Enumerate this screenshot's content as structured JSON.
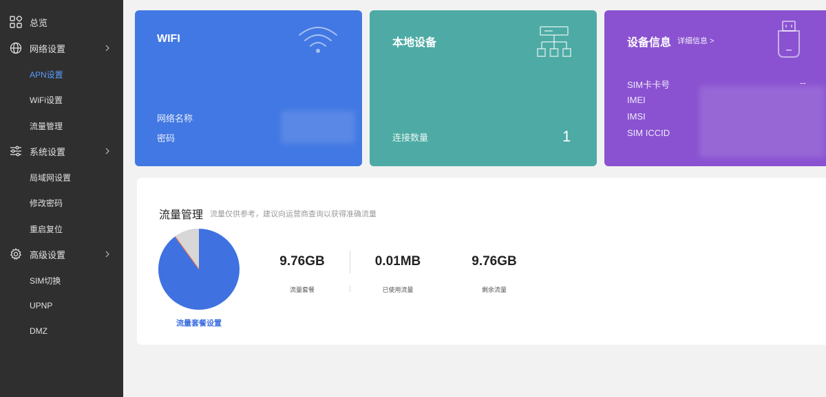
{
  "sidebar": {
    "items": [
      {
        "label": "总览",
        "icon": "grid-icon",
        "type": "parent"
      },
      {
        "label": "网络设置",
        "icon": "globe-icon",
        "type": "parent",
        "expandable": true
      },
      {
        "label": "APN设置",
        "type": "child",
        "active": true
      },
      {
        "label": "WiFi设置",
        "type": "child"
      },
      {
        "label": "流量管理",
        "type": "child"
      },
      {
        "label": "系统设置",
        "icon": "sliders-icon",
        "type": "parent",
        "expandable": true
      },
      {
        "label": "局域网设置",
        "type": "child"
      },
      {
        "label": "修改密码",
        "type": "child"
      },
      {
        "label": "重启复位",
        "type": "child"
      },
      {
        "label": "高级设置",
        "icon": "gear-icon",
        "type": "parent",
        "expandable": true
      },
      {
        "label": "SIM切换",
        "type": "child"
      },
      {
        "label": "UPNP",
        "type": "child"
      },
      {
        "label": "DMZ",
        "type": "child"
      }
    ]
  },
  "wifi_card": {
    "title": "WIFI",
    "icon": "wifi-icon",
    "network_name_label": "网络名称",
    "password_label": "密码",
    "color": "#4278e3"
  },
  "local_card": {
    "title": "本地设备",
    "icon": "network-topology-icon",
    "connections_label": "连接数量",
    "connections_value": "1",
    "color": "#4daaa4"
  },
  "info_card": {
    "title": "设备信息",
    "detail_link": "详细信息 >",
    "icon": "usb-stick-icon",
    "sim_number_label": "SIM卡卡号",
    "sim_number_value": "--",
    "imei_label": "IMEI",
    "imsi_label": "IMSI",
    "iccid_label": "SIM ICCID",
    "color": "#8a52d1"
  },
  "traffic": {
    "title": "流量管理",
    "hint": "流量仅供参考，建议向运营商查询以获得准确流量",
    "plan_link": "流量套餐设置",
    "stats": [
      {
        "value": "9.76GB",
        "label": "流量套餐"
      },
      {
        "value": "0.01MB",
        "label": "已使用流量"
      },
      {
        "value": "9.76GB",
        "label": "剩余流量"
      }
    ],
    "pie_colors": {
      "main": "#3f72e0",
      "secondary": "#d7d7d7",
      "accent": "#e8744a"
    }
  }
}
